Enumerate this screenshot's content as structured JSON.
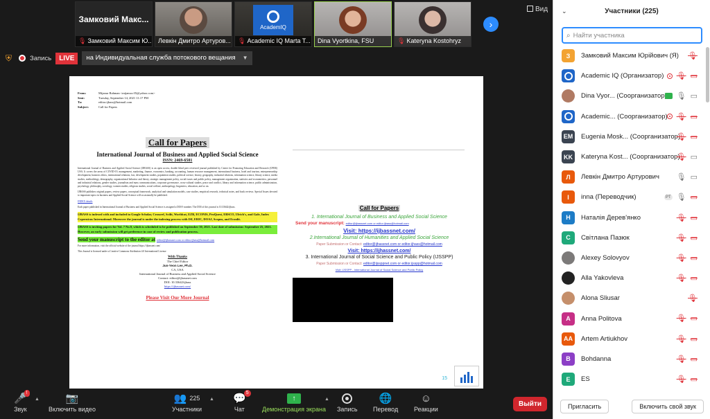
{
  "thumbnails": [
    {
      "big_name": "Замковий Макс...",
      "caption": "Замковий Максим Ю..."
    },
    {
      "caption": "Левкін Дмитро Артуров..."
    },
    {
      "logo_text": "AcademIQ",
      "caption": "Academic IQ Marta T..."
    },
    {
      "caption": "Dina Vyortkina, FSU"
    },
    {
      "caption": "Kateryna Kostohryz"
    }
  ],
  "view_label": "Вид",
  "recording": {
    "label": "Запись",
    "live": "LIVE",
    "stream": "на Индивидуальная служба потокового вещания"
  },
  "doc": {
    "header_rows": [
      {
        "k": "From:",
        "v": "Mijanur Rahman <mijanur.r35@yahoo.com>"
      },
      {
        "k": "Sent:",
        "v": "Tuesday, September 14, 2021 11:17 PM"
      },
      {
        "k": "To:",
        "v": "editor.ijbass@hotmail.com"
      },
      {
        "k": "Subject:",
        "v": "Call for Papers"
      }
    ],
    "cfp_title": "Call for Papers",
    "journal_title": "International Journal of Business and Applied Social Science",
    "issn": "ISSN: 2469-6501",
    "para1": "International Journal of Business and Applied Social Science (IJBASS) is an open access, double blind peer reviewed journal published by Center for Promoting Education and Research (CPER) USA. It covers the areas of COVID-19, management, marketing, finance, economics, banking, accounting, human resource management, international business, hotel and tourism, entrepreneurship development, business ethics, international relations, law, development studies, population studies, political science, history, geography, industrial relations, information science, library science, media studies, methodology, demography, organizational behavior and theory, strategic management policy, social issues and public policy, management organization, statistics and econometrics, personnel and industrial relations, gender studies, journalism and mass communications, corporate governance, cross-cultural studies, peace and conflict, library and information science, public administration, psychology, philosophy, sociology, women studies, religious studies, social welfare, anthropology, linguistics, education, and so on.",
    "para2": "IJBASS publishes original papers, review papers, conceptual framework, analytical and simulation models, case studies, empirical research, technical notes, and book reviews. Special Issues devoted to important topics in business and Applied Social Science will occasionally be published.",
    "indexing_link": "INDEX details",
    "para3": "Each paper published in International Journal of Business and Applied Social Science is assigned a DOI® number. The DOI of this journal is 10.33642/ijbass.",
    "indexed": "IJBASS is indexed with and included in Google Scholar, Crossref, Scilit, Worldcat, EZB, ECONIS, ProQuest, EBSCO, Ulrich's, and Gale, Index Copernicus International. Moreover the journal is under the indexing process with ISI, ERIC, DOAJ, Scopus, and Econlit.",
    "inviting": "IJBASS is inviting papers for Vol. 7 No.9, which is scheduled to be published on September 30, 2021. Last date of submission: September 25, 2021. However, an early submission will get preference in case of review and publication process.",
    "send_text": "Send your manuscript to the editor at",
    "send_emails": "editor@ijbassnet.com or editor.ijbass@hotmail.com",
    "more_info": "For more information, visit the official website of the journal https://ijbassnet.com/",
    "license": "This Journal is licensed under a Creative Commons Attribution 4.0 International License",
    "thanks": "With Thanks",
    "chief": "The Chief Editor",
    "editor_name": "Jun-Yeon Lee, Ph.D.",
    "ca": "CA, USA",
    "sig_journal": "International Journal of Business and Applied Social Science",
    "contact": "Contact: editor@ijbassnet.com",
    "doi": "DOI: 10.33642/ijbass",
    "site": "https://ijbassnet.com/",
    "visit_more": "Please Visit Our More Journal",
    "r_cfp": "Call for Papers",
    "r_j1": "1. International Journal of Business and Applied Social Science",
    "r_send": "Send your manuscript:",
    "r_send_emails": "editor@ijbassnet.com or editor.ijbass@hotmail.com",
    "r_visit1": "Visit: https://ijbassnet.com/",
    "r_j2": "2.International Journal of Humanities and Applied Social Science",
    "r_sub2": "Paper Submission or Contact:",
    "r_sub2_emails": "editor@ijhassnet.com or editor.ijhass@hotmail.com",
    "r_visit2": "Visit: https://ijhassnet.com/",
    "r_j3": "3. International Journal of Social Science and Public Policy (IJSSPP)",
    "r_sub3": "Paper Submission or Contact:",
    "r_sub3_emails": "editor@ijssppnet.com or editor.ijsspp@hotmail.com",
    "r_visit3": "Visit: IJSSPP - International Journal of Social Science and Public Policy",
    "page": "15"
  },
  "toolbar": {
    "audio": "Звук",
    "video": "Включить видео",
    "participants": "Участники",
    "participants_count": "225",
    "chat": "Чат",
    "chat_badge": "5",
    "share": "Демонстрация экрана",
    "record": "Запись",
    "translate": "Перевод",
    "reactions": "Реакции",
    "leave": "Выйти"
  },
  "panel": {
    "title": "Участники (225)",
    "search_placeholder": "Найти участника",
    "invite": "Пригласить",
    "unmute": "Включить свой звук",
    "participants": [
      {
        "initial": "З",
        "color": "#f3a332",
        "name": "Замковий Максим Юрійович (Я)",
        "icons": [
          "mic-off"
        ]
      },
      {
        "initial": "",
        "color": "#1f66c8",
        "logo": true,
        "name": "Academic IQ (Организатор)",
        "icons": [
          "rec",
          "mic-off",
          "cam-off"
        ]
      },
      {
        "initial": "",
        "color": "#b07a63",
        "photo": true,
        "name": "Dina Vyor... (Соорганизатор)",
        "icons": [
          "green",
          "mic-on",
          "cam-on"
        ]
      },
      {
        "initial": "",
        "color": "#1f66c8",
        "logo": true,
        "name": "Academic... (Соорганизатор)",
        "icons": [
          "rec",
          "mic-off",
          "cam-off"
        ]
      },
      {
        "initial": "EM",
        "color": "#3b4451",
        "name": "Eugenia Mosk... (Соорганизатор)",
        "icons": [
          "mic-off",
          "cam-off"
        ]
      },
      {
        "initial": "KK",
        "color": "#3b4451",
        "name": "Kateryna Kost... (Соорганизатор)",
        "icons": [
          "mic-off",
          "cam-on"
        ]
      },
      {
        "initial": "Л",
        "color": "#e8590c",
        "name": "Левкін Дмитро Артурович",
        "icons": [
          "mic-on",
          "cam-on"
        ]
      },
      {
        "initial": "I",
        "color": "#e8590c",
        "name": "inna (Переводчик)",
        "icons": [
          "pt",
          "mic-on",
          "cam-off"
        ]
      },
      {
        "initial": "Н",
        "color": "#1d7cc6",
        "name": "Наталія Дерев'янко",
        "icons": [
          "mic-off",
          "cam-off"
        ]
      },
      {
        "initial": "С",
        "color": "#1fa97a",
        "name": "Світлана Пазюк",
        "icons": [
          "mic-off",
          "cam-off"
        ]
      },
      {
        "initial": "",
        "color": "#7c7a79",
        "photo": true,
        "name": "Alexey Solovyov",
        "icons": [
          "mic-off",
          "cam-off"
        ]
      },
      {
        "initial": "",
        "color": "#222222",
        "photo": true,
        "name": "Alla Yakovleva",
        "icons": [
          "mic-off",
          "cam-off"
        ]
      },
      {
        "initial": "",
        "color": "#c58f6b",
        "photo": true,
        "name": "Alona Sliusar",
        "icons": [
          "mic-off"
        ]
      },
      {
        "initial": "A",
        "color": "#c62f86",
        "name": "Anna Politova",
        "icons": [
          "mic-off",
          "cam-off"
        ]
      },
      {
        "initial": "AA",
        "color": "#e8590c",
        "name": "Artem Artiukhov",
        "icons": [
          "mic-off",
          "cam-off"
        ]
      },
      {
        "initial": "B",
        "color": "#8c3fc6",
        "name": "Bohdanna",
        "icons": [
          "mic-off",
          "cam-off"
        ]
      },
      {
        "initial": "E",
        "color": "#1fa97a",
        "name": "ES",
        "icons": [
          "mic-off",
          "cam-off"
        ]
      }
    ]
  }
}
